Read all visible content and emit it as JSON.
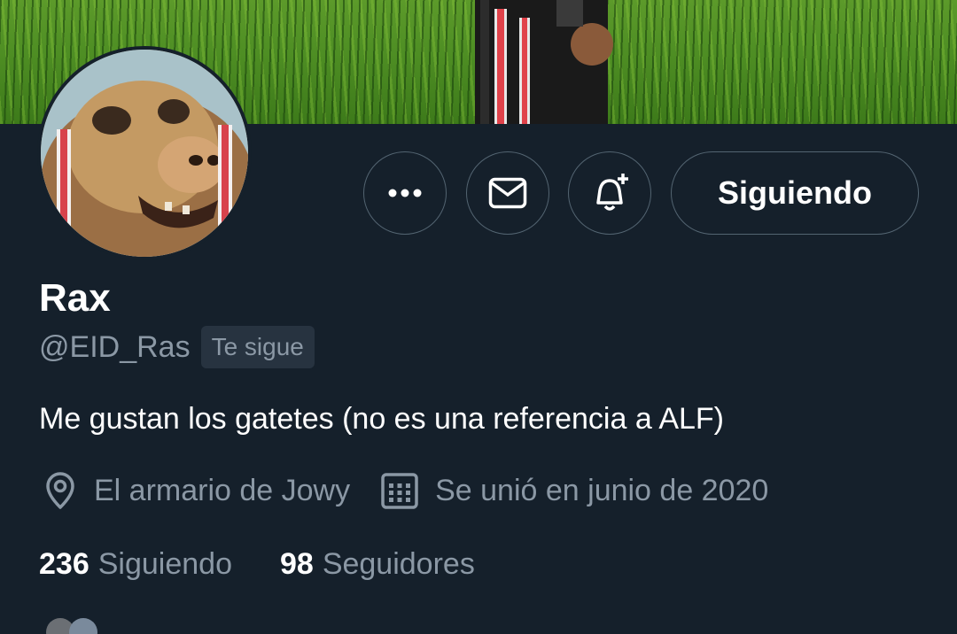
{
  "profile": {
    "name": "Rax",
    "handle": "@EID_Ras",
    "follows_you_label": "Te sigue",
    "bio": "Me gustan los gatetes (no es una referencia a ALF)",
    "location": "El armario de Jowy",
    "joined": "Se unió en junio de 2020",
    "following_count": "236",
    "following_label": "Siguiendo",
    "followers_count": "98",
    "followers_label": "Seguidores"
  },
  "actions": {
    "more_icon": "more-horizontal-icon",
    "message_icon": "envelope-icon",
    "notify_icon": "bell-plus-icon",
    "follow_button_label": "Siguiendo"
  },
  "icons": {
    "location": "map-pin-icon",
    "joined": "calendar-icon"
  },
  "colors": {
    "background": "#15202b",
    "secondary_text": "#8b98a5",
    "border": "#536471",
    "badge_bg": "#273340"
  }
}
